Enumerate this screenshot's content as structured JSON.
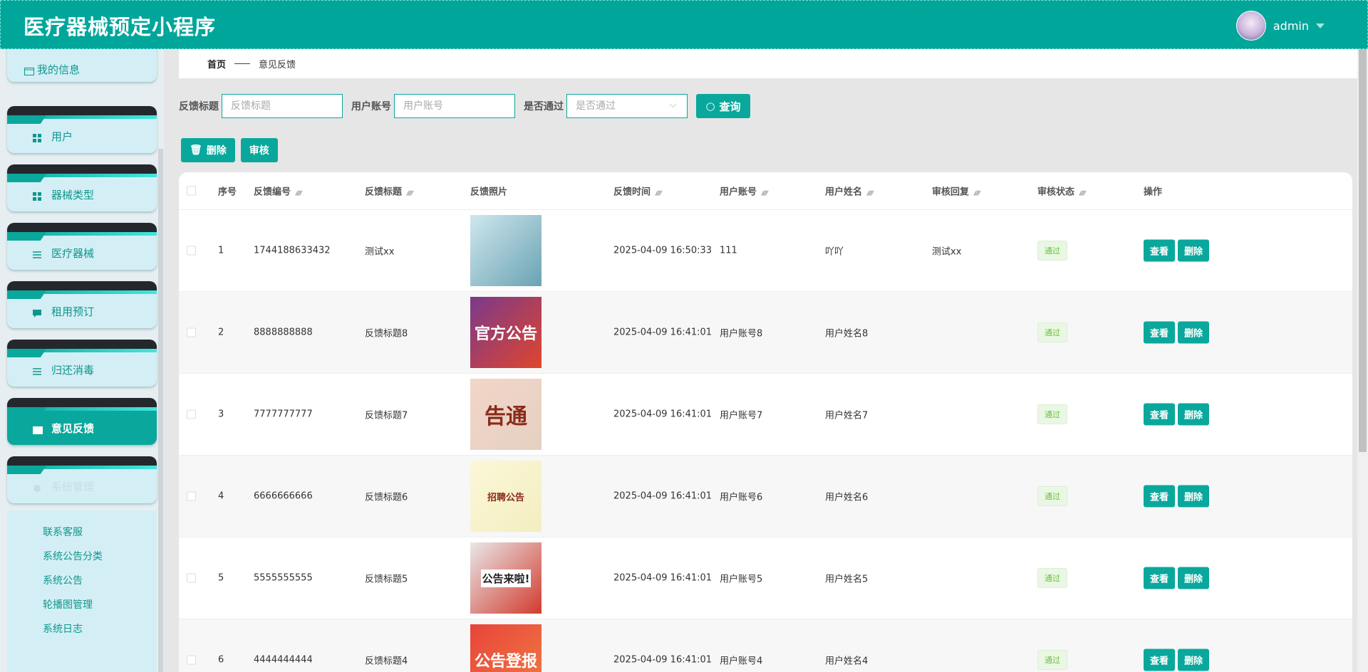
{
  "header": {
    "title": "医疗器械预定小程序",
    "username": "admin"
  },
  "sidebar": {
    "items": [
      {
        "label": "我的信息",
        "icon": "wallet-icon"
      },
      {
        "label": "用户",
        "icon": "grid-icon"
      },
      {
        "label": "器械类型",
        "icon": "grid-icon"
      },
      {
        "label": "医疗器械",
        "icon": "sliders-icon"
      },
      {
        "label": "租用预订",
        "icon": "message-icon"
      },
      {
        "label": "归还消毒",
        "icon": "list-icon"
      },
      {
        "label": "意见反馈",
        "icon": "wallet-icon",
        "active": true
      },
      {
        "label": "系统管理",
        "icon": "gear-icon"
      }
    ],
    "subitems": [
      "联系客服",
      "系统公告分类",
      "系统公告",
      "轮播图管理",
      "系统日志"
    ]
  },
  "breadcrumb": {
    "home": "首页",
    "current": "意见反馈"
  },
  "search": {
    "title_label": "反馈标题",
    "title_placeholder": "反馈标题",
    "account_label": "用户账号",
    "account_placeholder": "用户账号",
    "pass_label": "是否通过",
    "pass_placeholder": "是否通过",
    "query": "查询"
  },
  "actions": {
    "delete": "删除",
    "audit": "审核"
  },
  "table": {
    "columns": [
      "序号",
      "反馈编号",
      "反馈标题",
      "反馈照片",
      "反馈时间",
      "用户账号",
      "用户姓名",
      "审核回复",
      "审核状态",
      "操作"
    ],
    "view_label": "查看",
    "delete_label": "删除",
    "rows": [
      {
        "no": "1",
        "code": "1744188633432",
        "title": "测试xx",
        "time": "2025-04-09 16:50:33",
        "account": "111",
        "name": "吖吖",
        "reply": "测试xx",
        "status": "通过",
        "photo": [
          "#cfe7ee",
          "#6aa3b3"
        ],
        "photo_text": ""
      },
      {
        "no": "2",
        "code": "8888888888",
        "title": "反馈标题8",
        "time": "2025-04-09 16:41:01",
        "account": "用户账号8",
        "name": "用户姓名8",
        "reply": "",
        "status": "通过",
        "photo": [
          "#7a3a8a",
          "#e0452e"
        ],
        "photo_text": "官方公告"
      },
      {
        "no": "3",
        "code": "7777777777",
        "title": "反馈标题7",
        "time": "2025-04-09 16:41:01",
        "account": "用户账号7",
        "name": "用户姓名7",
        "reply": "",
        "status": "通过",
        "photo": [
          "#f3d6c8",
          "#e4d0c2"
        ],
        "photo_text": "告通"
      },
      {
        "no": "4",
        "code": "6666666666",
        "title": "反馈标题6",
        "time": "2025-04-09 16:41:01",
        "account": "用户账号6",
        "name": "用户姓名6",
        "reply": "",
        "status": "通过",
        "photo": [
          "#fbf7d8",
          "#f3eec0"
        ],
        "photo_text": "招聘公告"
      },
      {
        "no": "5",
        "code": "5555555555",
        "title": "反馈标题5",
        "time": "2025-04-09 16:41:01",
        "account": "用户账号5",
        "name": "用户姓名5",
        "reply": "",
        "status": "通过",
        "photo": [
          "#e8e8e8",
          "#d23b2f"
        ],
        "photo_text": "公告来啦!"
      },
      {
        "no": "6",
        "code": "4444444444",
        "title": "反馈标题4",
        "time": "2025-04-09 16:41:01",
        "account": "用户账号4",
        "name": "用户姓名4",
        "reply": "",
        "status": "通过",
        "photo": [
          "#e8453a",
          "#f07a42"
        ],
        "photo_text": "公告登报"
      }
    ]
  }
}
